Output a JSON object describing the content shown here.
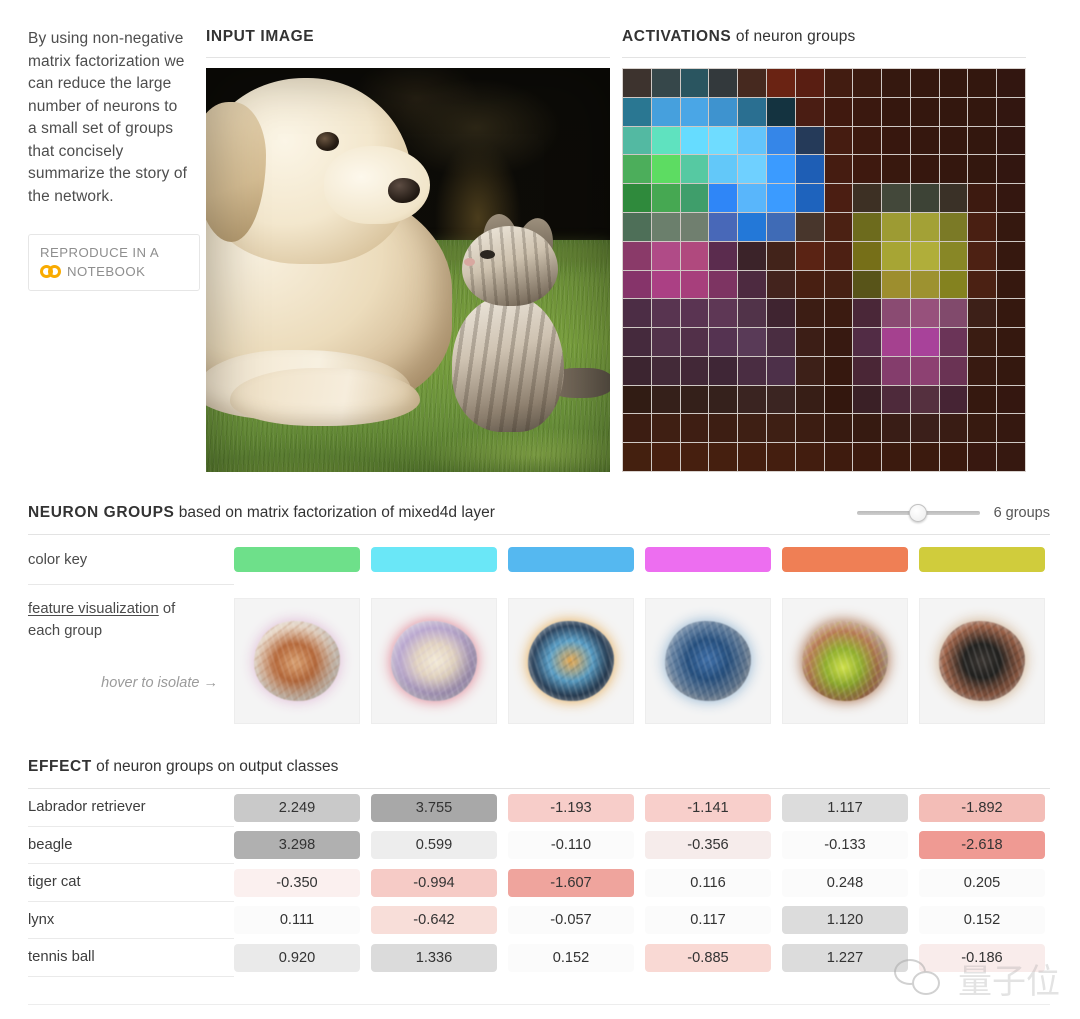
{
  "intro": {
    "paragraph": "By using non-negative matrix factorization we can reduce the large number of neurons to a small set of groups that concisely summarize the story of the network.",
    "button_line1": "REPRODUCE IN A",
    "button_line2": "NOTEBOOK",
    "button_icon": "colab-logo-icon"
  },
  "input_panel": {
    "title_bold": "INPUT IMAGE",
    "title_rest": "",
    "image_alt": "puppy and kitten on grass"
  },
  "activations_panel": {
    "title_bold": "ACTIVATIONS",
    "title_rest": " of neuron groups",
    "grid_size": 14
  },
  "neuron_groups": {
    "title_bold": "NEURON GROUPS",
    "title_rest": " based on matrix factorization of mixed4d layer",
    "slider_value": "6 groups",
    "slider_percent": 50,
    "color_key_label": "color key",
    "fviz_label_line1_underlined": "feature visualization",
    "fviz_label_line1_rest": " of",
    "fviz_label_line2": "each group",
    "hover_hint": "hover to isolate →",
    "colors": [
      "#6ee08a",
      "#6ae7f7",
      "#55b8f0",
      "#ed6ef0",
      "#ef7f55",
      "#d0cc3c"
    ]
  },
  "effect": {
    "title_bold": "EFFECT",
    "title_rest": " of neuron groups on output classes",
    "rows": [
      {
        "label": "Labrador retriever",
        "values": [
          "2.249",
          "3.755",
          "-1.193",
          "-1.141",
          "1.117",
          "-1.892"
        ]
      },
      {
        "label": "beagle",
        "values": [
          "3.298",
          "0.599",
          "-0.110",
          "-0.356",
          "-0.133",
          "-2.618"
        ]
      },
      {
        "label": "tiger cat",
        "values": [
          "-0.350",
          "-0.994",
          "-1.607",
          "0.116",
          "0.248",
          "0.205"
        ]
      },
      {
        "label": "lynx",
        "values": [
          "0.111",
          "-0.642",
          "-0.057",
          "0.117",
          "1.120",
          "0.152"
        ]
      },
      {
        "label": "tennis ball",
        "values": [
          "0.920",
          "1.336",
          "0.152",
          "-0.885",
          "1.227",
          "-0.186"
        ]
      }
    ],
    "cell_colors": [
      [
        "#c9c9c9",
        "#a8a8a8",
        "#f7cdc9",
        "#f8cfcb",
        "#dcdcdc",
        "#f3bdb7"
      ],
      [
        "#b0b0b0",
        "#ededed",
        "#fbfbfb",
        "#f6eceb",
        "#fbfbfb",
        "#ef9a93"
      ],
      [
        "#fbf0ef",
        "#f6cbc6",
        "#efa49d",
        "#fbfbfb",
        "#fbfbfb",
        "#fbfbfb"
      ],
      [
        "#fbfbfb",
        "#f8ded9",
        "#fbfbfb",
        "#fbfbfb",
        "#dcdcdc",
        "#fbfbfb"
      ],
      [
        "#eaeaea",
        "#dbdbdb",
        "#fbfbfb",
        "#f9d9d4",
        "#dcdcdc",
        "#f9eceb"
      ]
    ]
  },
  "chart_data": {
    "type": "heatmap",
    "title": "EFFECT of neuron groups on output classes",
    "categories": [
      "Labrador retriever",
      "beagle",
      "tiger cat",
      "lynx",
      "tennis ball"
    ],
    "columns": [
      "group 1 (green)",
      "group 2 (cyan)",
      "group 3 (blue)",
      "group 4 (magenta)",
      "group 5 (orange)",
      "group 6 (yellow)"
    ],
    "values": [
      [
        2.249,
        3.755,
        -1.193,
        -1.141,
        1.117,
        -1.892
      ],
      [
        3.298,
        0.599,
        -0.11,
        -0.356,
        -0.133,
        -2.618
      ],
      [
        -0.35,
        -0.994,
        -1.607,
        0.116,
        0.248,
        0.205
      ],
      [
        0.111,
        -0.642,
        -0.057,
        0.117,
        1.12,
        0.152
      ],
      [
        0.92,
        1.336,
        0.152,
        -0.885,
        1.227,
        -0.186
      ]
    ],
    "xlabel": "neuron group",
    "ylabel": "output class",
    "colormap": "gray-positive / red-negative",
    "grid": false,
    "legend": "none"
  },
  "watermark": {
    "text": "量子位",
    "icon": "wechat-icon"
  }
}
